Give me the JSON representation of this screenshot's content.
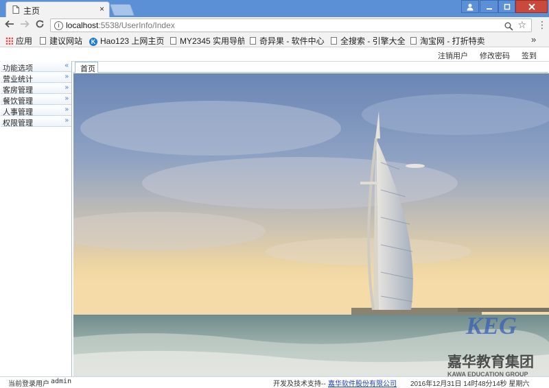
{
  "browser": {
    "tab_title": "主页",
    "close_glyph": "×",
    "url_host": "localhost",
    "url_rest": ":5538/UserInfo/Index",
    "bookmarks": [
      {
        "label": "应用",
        "icon": "apps-grid-icon"
      },
      {
        "label": "建议网站",
        "icon": "page-icon"
      },
      {
        "label": "Hao123 上网主页",
        "icon": "k-logo-icon"
      },
      {
        "label": "MY2345 实用导航",
        "icon": "page-icon"
      },
      {
        "label": "奇异果 - 软件中心",
        "icon": "page-icon"
      },
      {
        "label": "全搜索 - 引擎大全",
        "icon": "page-icon"
      },
      {
        "label": "淘宝网 - 打折特卖",
        "icon": "page-icon"
      }
    ]
  },
  "header_links": {
    "logout": "注销用户",
    "change_password": "修改密码",
    "sign_in": "签到"
  },
  "sidebar": {
    "title": "功能选项",
    "items": [
      {
        "label": "营业统计"
      },
      {
        "label": "客房管理"
      },
      {
        "label": "餐饮管理"
      },
      {
        "label": "人事管理"
      },
      {
        "label": "权限管理"
      }
    ]
  },
  "main": {
    "home_tab": "首页",
    "watermark": {
      "brand": "KEG",
      "name": "嘉华教育集团",
      "english": "KAWA EDUCATION GROUP"
    }
  },
  "footer": {
    "current_user_label": "当前登录用户",
    "current_user": "admin",
    "support_label": "开发及技术支持--",
    "company": "嘉华软件股份有限公司",
    "datetime": "2016年12月31日  14时48分14秒  星期六"
  },
  "colors": {
    "titlebar": "#5b8fd6",
    "link": "#1a3fb5",
    "border": "#a9bcd6"
  }
}
